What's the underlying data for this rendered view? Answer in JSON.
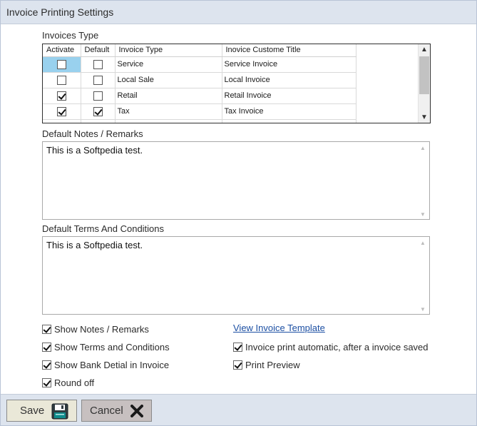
{
  "window": {
    "title": "Invoice Printing Settings"
  },
  "invoice_types": {
    "label": "Invoices Type",
    "columns": [
      "Activate",
      "Default",
      "Invoice Type",
      "Inovice Custome Title"
    ],
    "rows": [
      {
        "activate": false,
        "default": false,
        "type": "Service",
        "title": "Service Invoice"
      },
      {
        "activate": false,
        "default": false,
        "type": "Local Sale",
        "title": "Local Invoice"
      },
      {
        "activate": true,
        "default": false,
        "type": "Retail",
        "title": "Retail Invoice"
      },
      {
        "activate": true,
        "default": true,
        "type": "Tax",
        "title": "Tax Invoice"
      }
    ]
  },
  "notes": {
    "label": "Default Notes / Remarks",
    "value": "This is a Softpedia test."
  },
  "terms": {
    "label": "Default Terms And Conditions",
    "value": "This is a Softpedia test."
  },
  "options": {
    "show_notes": {
      "label": "Show Notes / Remarks",
      "checked": true
    },
    "show_terms": {
      "label": "Show Terms and Conditions",
      "checked": true
    },
    "show_bank": {
      "label": "Show Bank Detial in Invoice",
      "checked": true
    },
    "round_off": {
      "label": "Round off",
      "checked": true
    },
    "view_template": "View Invoice Template",
    "auto_print": {
      "label": "Invoice print automatic, after a invoice saved",
      "checked": true
    },
    "print_preview": {
      "label": "Print Preview",
      "checked": true
    }
  },
  "footer": {
    "save_label": "Save",
    "cancel_label": "Cancel"
  },
  "colors": {
    "accent": "#1c4fa3",
    "selection": "#99d1ee",
    "chrome": "#dde4ee"
  }
}
